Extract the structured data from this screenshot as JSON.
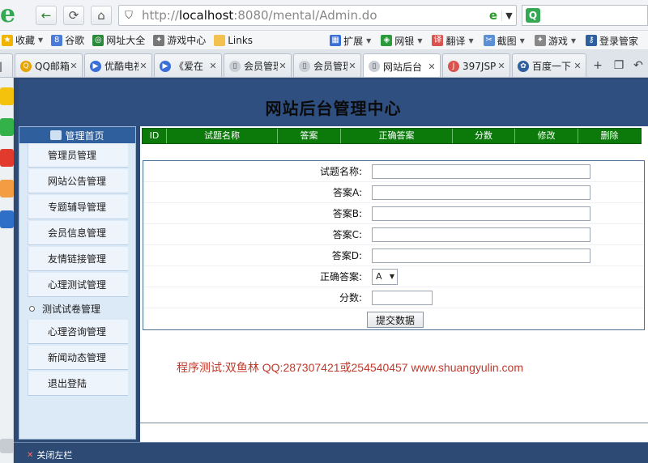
{
  "browser": {
    "url_prefix": "http://",
    "url_host": "localhost",
    "url_rest": ":8080/mental/Admin.do",
    "search_icon": "search-icon",
    "favbar": {
      "favorites": "收藏",
      "items": [
        "谷歌",
        "网址大全",
        "游戏中心",
        "Links"
      ],
      "right": [
        "扩展",
        "网银",
        "翻译",
        "截图",
        "游戏",
        "登录管家"
      ]
    },
    "tabs": [
      "QQ邮箱",
      "优酷电视",
      "《爱在",
      "会员管理",
      "会员管理",
      "网站后台",
      "397JSP",
      "百度一下"
    ]
  },
  "header": {
    "title": "网站后台管理中心"
  },
  "sidebar": {
    "head": "管理首页",
    "items": [
      "管理员管理",
      "网站公告管理",
      "专题辅导管理",
      "会员信息管理",
      "友情链接管理",
      "心理测试管理",
      "测试试卷管理",
      "心理咨询管理",
      "新闻动态管理",
      "退出登陆"
    ]
  },
  "grid": {
    "columns": [
      "ID",
      "试题名称",
      "答案",
      "正确答案",
      "分数",
      "修改",
      "删除"
    ]
  },
  "form": {
    "name_label": "试题名称:",
    "a_label": "答案A:",
    "b_label": "答案B:",
    "c_label": "答案C:",
    "d_label": "答案D:",
    "correct_label": "正确答案:",
    "correct_value": "A",
    "score_label": "分数:",
    "submit_label": "提交数据"
  },
  "credit": "程序测试:双鱼林 QQ:287307421或254540457 www.shuangyulin.com",
  "footer": {
    "close_label": "关闭左栏"
  }
}
